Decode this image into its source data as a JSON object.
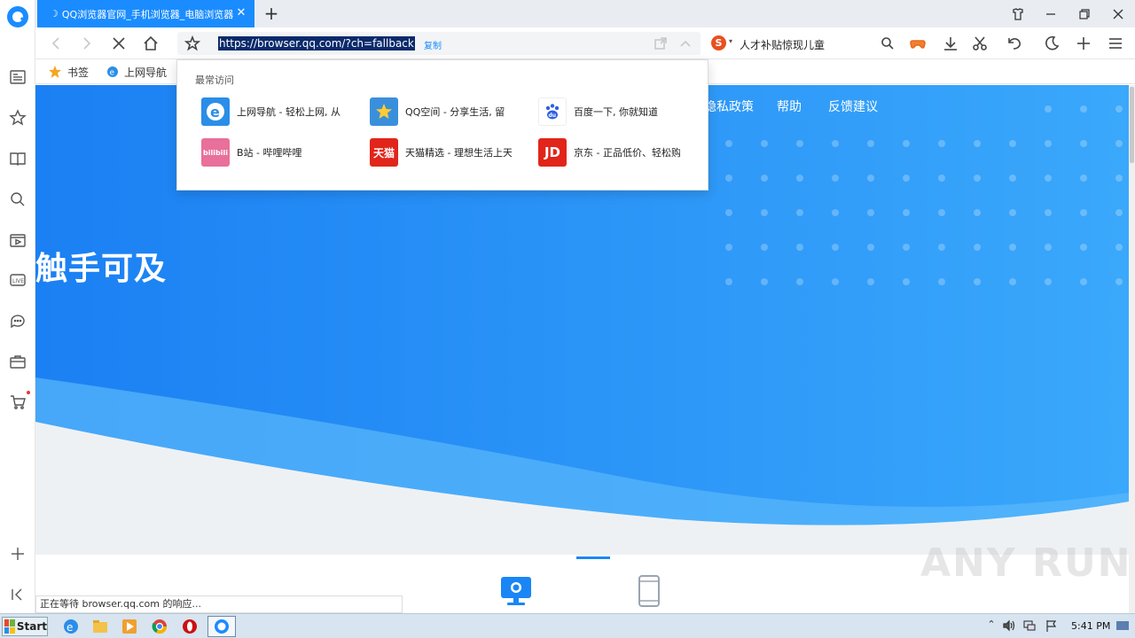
{
  "tab": {
    "title": "QQ浏览器官网_手机浏览器_电脑浏览器",
    "spinner": "☽",
    "close": "✕"
  },
  "toolbar": {
    "url": "https://browser.qq.com/?ch=fallback",
    "copy_label": "复制"
  },
  "search": {
    "engine_glyph": "S",
    "caret": "▾",
    "text": "人才补贴惊现儿童"
  },
  "bookmarks": [
    {
      "label": "书签",
      "icon": "star-icon"
    },
    {
      "label": "上网导航",
      "icon": "ie-icon"
    }
  ],
  "dropdown": {
    "title": "最常访问",
    "sites": [
      {
        "label": "上网导航 - 轻松上网, 从",
        "icon_text": "e",
        "color": "#2a8ee8"
      },
      {
        "label": "QQ空间 - 分享生活, 留",
        "icon_text": "★",
        "color": "#3a8fdc"
      },
      {
        "label": "百度一下, 你就知道",
        "icon_text": "du",
        "color": "#ffffff"
      },
      {
        "label": "B站 - 哔哩哔哩",
        "icon_text": "bilibili",
        "color": "#e8709a"
      },
      {
        "label": "天猫精选 - 理想生活上天",
        "icon_text": "天猫",
        "color": "#e1251b"
      },
      {
        "label": "京东 - 正品低价、轻松购",
        "icon_text": "JD",
        "color": "#e1251b"
      }
    ]
  },
  "page": {
    "nav": [
      "隐私政策",
      "帮助",
      "反馈建议"
    ],
    "hero": "触手可及"
  },
  "status": "正在等待 browser.qq.com 的响应...",
  "taskbar": {
    "start": "Start",
    "clock": "5:41 PM"
  },
  "watermark": "ANY RUN",
  "colors": {
    "accent": "#1a8cff",
    "page_blue": "#1a86f5"
  }
}
